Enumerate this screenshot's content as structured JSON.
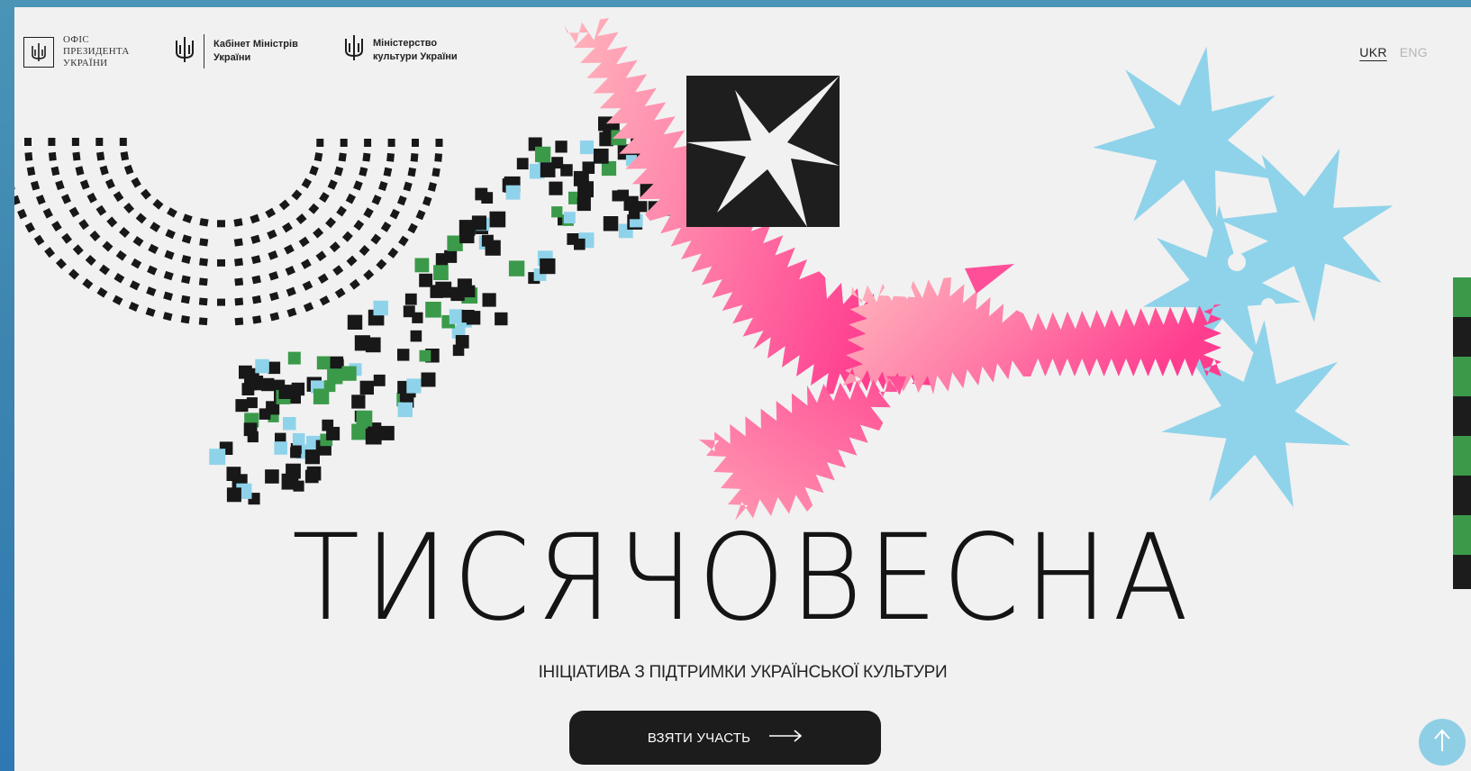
{
  "header": {
    "logos": [
      {
        "name": "office-president",
        "lines": [
          "ОФІС",
          "ПРЕЗИДЕНТА",
          "УКРАЇНИ"
        ]
      },
      {
        "name": "cabinet-ministers",
        "lines": [
          "Кабінет Міністрів",
          "України"
        ]
      },
      {
        "name": "ministry-culture",
        "lines": [
          "Міністерство",
          "культури України"
        ]
      }
    ],
    "languages": [
      {
        "label": "UKR",
        "active": true
      },
      {
        "label": "ENG",
        "active": false
      }
    ]
  },
  "hero": {
    "title": "ТИСЯЧОВЕСНА",
    "subtitle": "ІНІЦІАТИВА З ПІДТРИМКИ УКРАЇНСЬКОЇ КУЛЬТУРИ",
    "cta_label": "ВЗЯТИ УЧАСТЬ"
  },
  "colors": {
    "background": "#f1f1f1",
    "frame": "#3d85b0",
    "ink": "#1c1c1c",
    "pink_start": "#ffb3bd",
    "pink_end": "#ff3d8f",
    "sky_blue": "#8fd3ea",
    "green": "#3b9a4a"
  },
  "icons": {
    "trident": "trident-icon",
    "cta_arrow": "arrow-right-icon",
    "scroll_top": "arrow-up-icon"
  }
}
